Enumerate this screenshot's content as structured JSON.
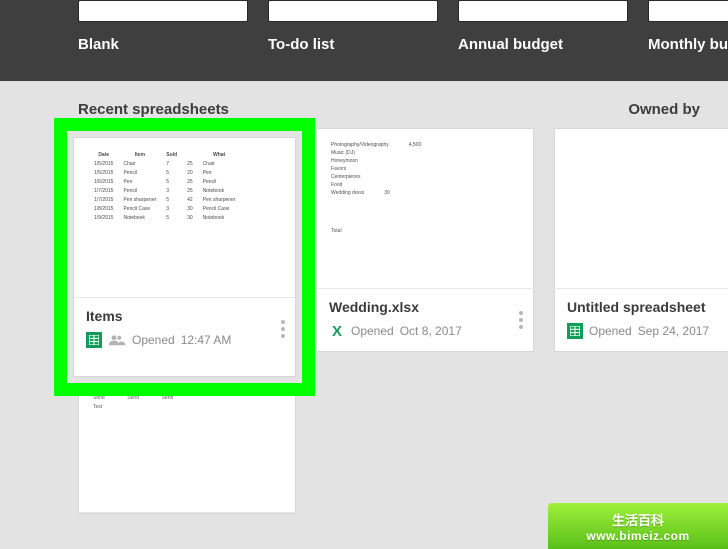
{
  "templates": [
    {
      "label": "Blank"
    },
    {
      "label": "To-do list"
    },
    {
      "label": "Annual budget"
    },
    {
      "label": "Monthly budg"
    }
  ],
  "section": {
    "title": "Recent spreadsheets",
    "owner_label": "Owned by"
  },
  "highlighted": {
    "title": "Items",
    "opened_prefix": "Opened",
    "opened_value": "12:47 AM"
  },
  "cards": [
    {
      "title": "Wedding.xlsx",
      "opened_prefix": "Opened",
      "opened_value": "Oct 8, 2017",
      "type": "excel"
    },
    {
      "title": "Untitled spreadsheet",
      "opened_prefix": "Opened",
      "opened_value": "Sep 24, 2017",
      "type": "sheets"
    }
  ],
  "watermark": {
    "line1": "生活百科",
    "line2": "www.bimeiz.com"
  }
}
